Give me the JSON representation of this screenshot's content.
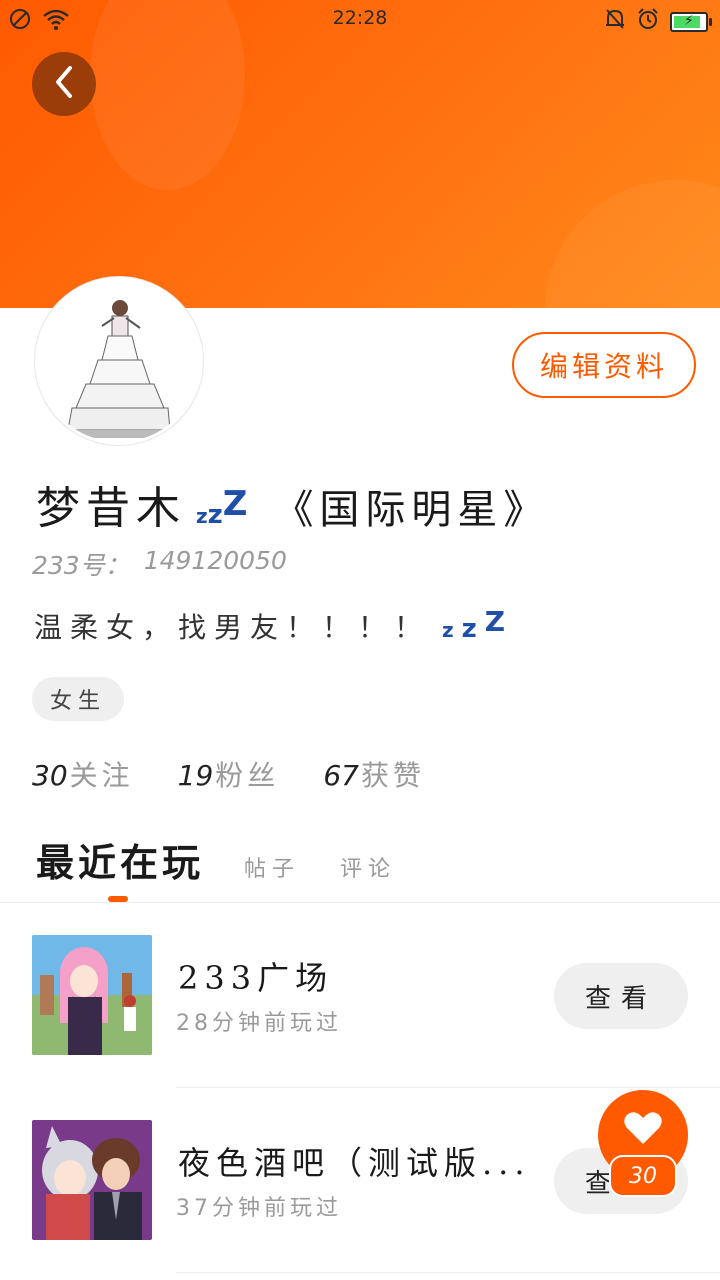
{
  "status_bar": {
    "time": "22:28",
    "left_icons": [
      "no-sim-icon",
      "wifi-icon"
    ],
    "right_icons": [
      "alarm-off-icon",
      "alarm-clock-icon",
      "battery-charging-icon"
    ],
    "battery_color": "#4cd964"
  },
  "colors": {
    "accent": "#ff5a00",
    "header_gradient": [
      "#ff5a00",
      "#ff8a1a"
    ]
  },
  "header": {
    "back_icon": "chevron-left-icon"
  },
  "profile": {
    "edit_label": "编辑资料",
    "name": "梦昔木",
    "sleep_icon": "zzz-icon",
    "zzz_small": "z",
    "zzz_mid": "z",
    "zzz_big": "Z",
    "title": "《国际明星》",
    "uid_label": "233号：",
    "uid_value": "149120050",
    "bio": "温柔女，找男友！！！！",
    "gender": "女生",
    "stats": [
      {
        "num": "30",
        "label": "关注"
      },
      {
        "num": "19",
        "label": "粉丝"
      },
      {
        "num": "67",
        "label": "获赞"
      }
    ]
  },
  "tabs": {
    "active": "最近在玩",
    "items": [
      "帖子",
      "评论"
    ]
  },
  "games": [
    {
      "name": "233广场",
      "time": "28分钟前玩过",
      "button": "查看"
    },
    {
      "name": "夜色酒吧（测试版...",
      "time": "37分钟前玩过",
      "button": "查看"
    }
  ],
  "like_fab": {
    "icon": "heart-icon",
    "count": "30"
  }
}
